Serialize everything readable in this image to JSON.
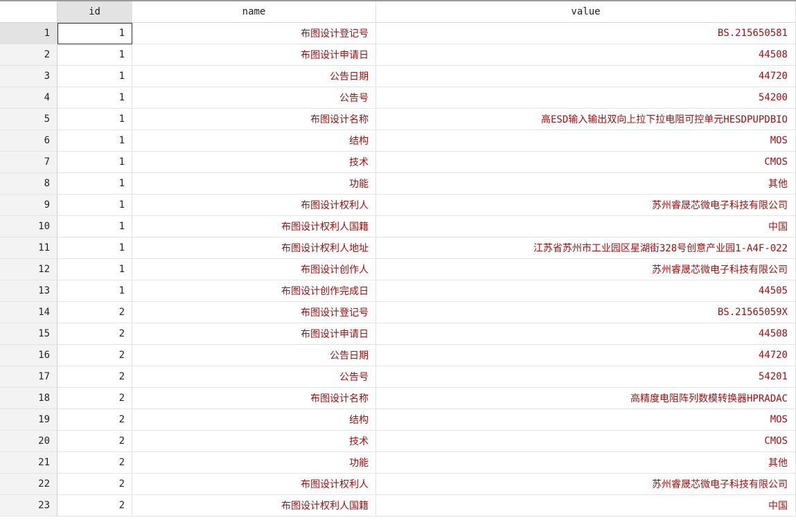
{
  "columns": {
    "id": "id",
    "name": "name",
    "value": "value"
  },
  "rows": [
    {
      "n": "1",
      "id": "1",
      "name": "布图设计登记号",
      "value": "BS.215650581"
    },
    {
      "n": "2",
      "id": "1",
      "name": "布图设计申请日",
      "value": "44508"
    },
    {
      "n": "3",
      "id": "1",
      "name": "公告日期",
      "value": "44720"
    },
    {
      "n": "4",
      "id": "1",
      "name": "公告号",
      "value": "54200"
    },
    {
      "n": "5",
      "id": "1",
      "name": "布图设计名称",
      "value": "高ESD输入输出双向上拉下拉电阻可控单元HESDPUPDBIO"
    },
    {
      "n": "6",
      "id": "1",
      "name": "结构",
      "value": "MOS"
    },
    {
      "n": "7",
      "id": "1",
      "name": "技术",
      "value": "CMOS"
    },
    {
      "n": "8",
      "id": "1",
      "name": "功能",
      "value": "其他"
    },
    {
      "n": "9",
      "id": "1",
      "name": "布图设计权利人",
      "value": "苏州睿晟芯微电子科技有限公司"
    },
    {
      "n": "10",
      "id": "1",
      "name": "布图设计权利人国籍",
      "value": "中国"
    },
    {
      "n": "11",
      "id": "1",
      "name": "布图设计权利人地址",
      "value": "江苏省苏州市工业园区星湖街328号创意产业园1-A4F-022"
    },
    {
      "n": "12",
      "id": "1",
      "name": "布图设计创作人",
      "value": "苏州睿晟芯微电子科技有限公司"
    },
    {
      "n": "13",
      "id": "1",
      "name": "布图设计创作完成日",
      "value": "44505"
    },
    {
      "n": "14",
      "id": "2",
      "name": "布图设计登记号",
      "value": "BS.21565059X"
    },
    {
      "n": "15",
      "id": "2",
      "name": "布图设计申请日",
      "value": "44508"
    },
    {
      "n": "16",
      "id": "2",
      "name": "公告日期",
      "value": "44720"
    },
    {
      "n": "17",
      "id": "2",
      "name": "公告号",
      "value": "54201"
    },
    {
      "n": "18",
      "id": "2",
      "name": "布图设计名称",
      "value": "高精度电阻阵列数模转换器HPRADAC"
    },
    {
      "n": "19",
      "id": "2",
      "name": "结构",
      "value": "MOS"
    },
    {
      "n": "20",
      "id": "2",
      "name": "技术",
      "value": "CMOS"
    },
    {
      "n": "21",
      "id": "2",
      "name": "功能",
      "value": "其他"
    },
    {
      "n": "22",
      "id": "2",
      "name": "布图设计权利人",
      "value": "苏州睿晟芯微电子科技有限公司"
    },
    {
      "n": "23",
      "id": "2",
      "name": "布图设计权利人国籍",
      "value": "中国"
    }
  ],
  "colors": {
    "string_text": "#a01010",
    "numeric_text": "#222222",
    "selected_header": "#e3e3e3"
  }
}
